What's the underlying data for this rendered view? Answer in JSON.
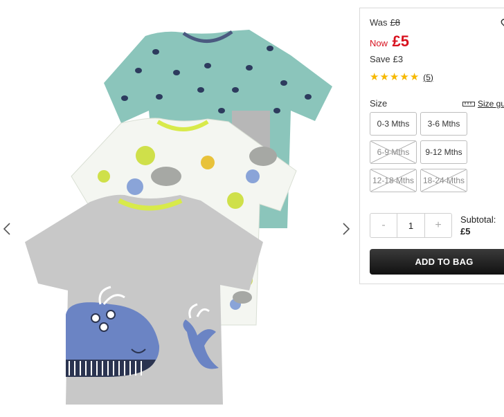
{
  "price": {
    "was_label": "Was",
    "was_value": "£8",
    "now_label": "Now",
    "now_value": "£5",
    "save_label": "Save",
    "save_value": "£3"
  },
  "rating": {
    "stars": 5,
    "reviews": "(5)",
    "star_color": "#f6b800"
  },
  "size": {
    "label": "Size",
    "guide_label": "Size gu",
    "options": [
      {
        "label": "0-3 Mths",
        "available": true
      },
      {
        "label": "3-6 Mths",
        "available": true
      },
      {
        "label": "6-9 Mths",
        "available": false
      },
      {
        "label": "9-12 Mths",
        "available": true
      },
      {
        "label": "12-18 Mths",
        "available": false
      },
      {
        "label": "18-24 Mths",
        "available": false
      }
    ]
  },
  "quantity": {
    "minus": "-",
    "value": "1",
    "plus": "+"
  },
  "subtotal": {
    "label": "Subtotal:",
    "value": "£5"
  },
  "add_to_bag": "ADD TO BAG",
  "colors": {
    "sale_red": "#d8121f",
    "button_dark": "#1c1c1c"
  }
}
